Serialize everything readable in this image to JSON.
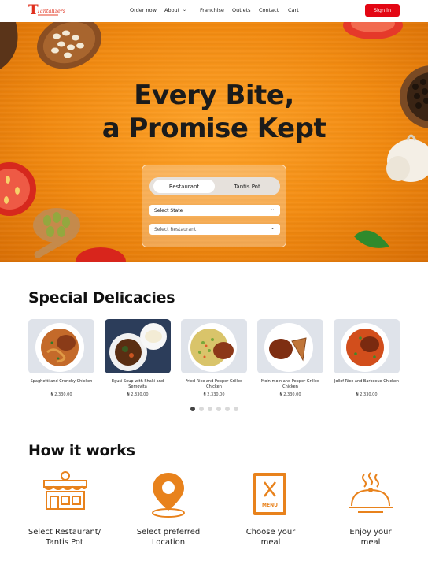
{
  "nav": {
    "logo_text": "Tantalizers",
    "links": [
      "Order now",
      "About",
      "Franchise",
      "Outlets",
      "Contact",
      "Cart"
    ],
    "signin_label": "Sign in"
  },
  "hero": {
    "title_line1": "Every Bite,",
    "title_line2": "a Promise Kept",
    "tabs": [
      "Restaurant",
      "Tantis Pot"
    ],
    "active_tab": "Restaurant",
    "select_state": "Select State",
    "select_restaurant": "Select Restaurant"
  },
  "delicacies": {
    "title": "Special Delicacies",
    "items": [
      {
        "name": "Spaghetti and Crunchy Chicken",
        "price": "₦ 2,330.00"
      },
      {
        "name": "Egusi Soup with Shaki and Semovita",
        "price": "₦ 2,330.00"
      },
      {
        "name": "Fried Rice and Pepper Grilled Chicken",
        "price": "₦ 2,330.00"
      },
      {
        "name": "Moin-moin and Pepper Grilled Chicken",
        "price": "₦ 2,330.00"
      },
      {
        "name": "Jollof Rice and Barbecue Chicken",
        "price": "₦ 2,330.00"
      }
    ],
    "carousel_pages": 6,
    "carousel_active": 1
  },
  "how_it_works": {
    "title": "How it works",
    "steps": [
      {
        "line1": "Select Restaurant/",
        "line2": "Tantis Pot",
        "icon": "restaurant-building-icon"
      },
      {
        "line1": "Select preferred",
        "line2": "Location",
        "icon": "location-pin-icon"
      },
      {
        "line1": "Choose your",
        "line2": "meal",
        "icon": "menu-book-icon"
      },
      {
        "line1": "Enjoy your",
        "line2": "meal",
        "icon": "food-cloche-icon"
      }
    ]
  },
  "colors": {
    "brand_red": "#e30613",
    "accent_orange": "#f28a10",
    "icon_orange": "#e8821c"
  }
}
